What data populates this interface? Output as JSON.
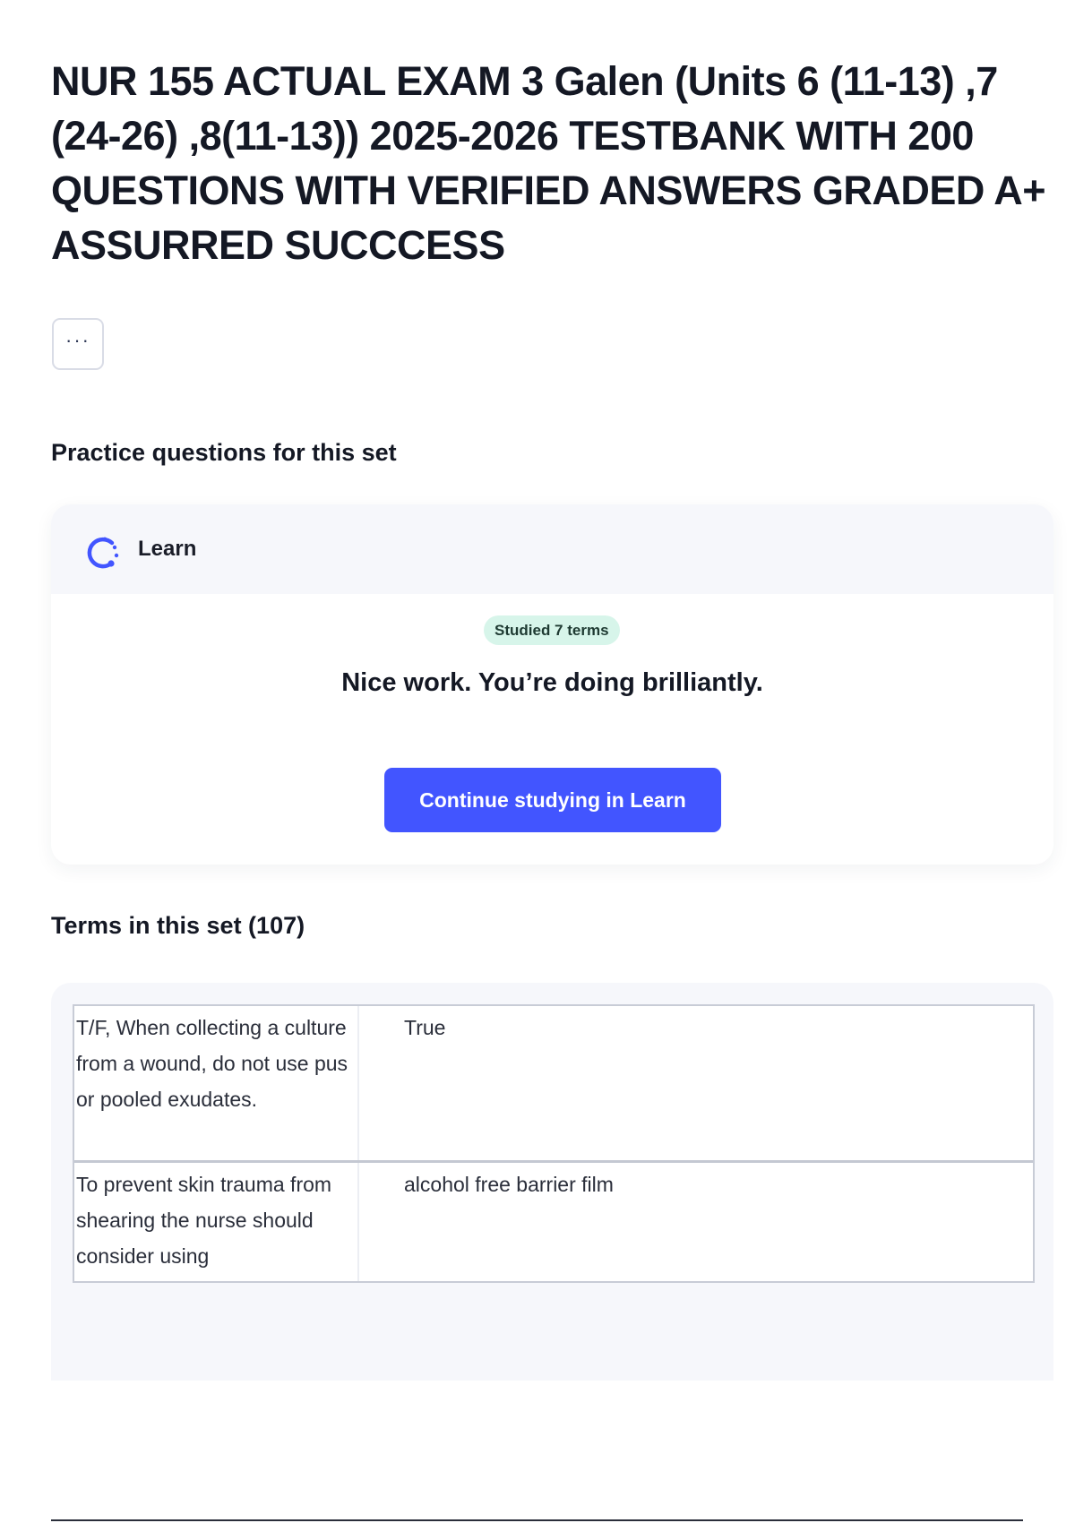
{
  "page": {
    "title": "NUR 155 ACTUAL EXAM 3 Galen (Units 6 (11-13) ,7 (24-26) ,8(11-13)) 2025-2026 TESTBANK WITH 200 QUESTIONS WITH VERIFIED ANSWERS GRADED A+ ASSURRED SUCCCESS"
  },
  "actions": {
    "more_icon": "more-horizontal-icon",
    "more_glyph": "···"
  },
  "practice": {
    "heading": "Practice questions for this set",
    "mode_label": "Learn",
    "mode_icon": "learn-progress-icon",
    "badge": "Studied 7 terms",
    "message": "Nice work. You’re doing brilliantly.",
    "button_label": "Continue studying in Learn",
    "accent_color": "#4255ff",
    "badge_color": "#d7f5ea"
  },
  "terms": {
    "heading": "Terms in this set (107)",
    "items": [
      {
        "term": "T/F, When collecting a culture from a wound, do not use pus or pooled exudates.",
        "definition": "True"
      },
      {
        "term": "To prevent skin trauma from shearing the nurse should consider using",
        "definition": "alcohol free barrier film"
      }
    ]
  }
}
